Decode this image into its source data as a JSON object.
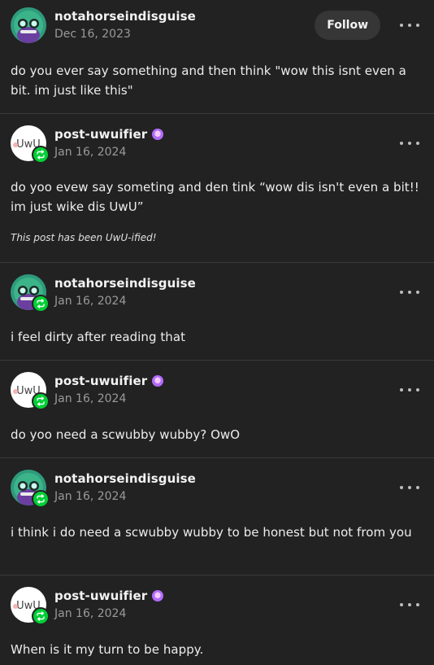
{
  "follow_label": "Follow",
  "uwu_note": "This post has been UwU-ified!",
  "colors": {
    "background": "#222222",
    "reblog_badge": "#00cf35",
    "follow_button": "#363636"
  },
  "posts": [
    {
      "author": "notahorseindisguise",
      "date": "Dec 16, 2023",
      "text": "do you ever say something and then think \"wow this isnt even a bit. im just like this\"",
      "avatar": "horse-glasses-avatar",
      "reblog_icon": false
    },
    {
      "author": "post-uwuifier",
      "date": "Jan 16, 2024",
      "text": "do yoo evew say someting and den tink “wow dis isn't even a bit!! im just wike dis UwU”",
      "avatar": "uwu-face-avatar",
      "reblog_icon": true,
      "badge": "purple-blue-badge-icon"
    },
    {
      "author": "notahorseindisguise",
      "date": "Jan 16, 2024",
      "text": "i feel dirty after reading that",
      "avatar": "horse-glasses-avatar",
      "reblog_icon": true
    },
    {
      "author": "post-uwuifier",
      "date": "Jan 16, 2024",
      "text": "do yoo need a scwubby wubby? OwO",
      "avatar": "uwu-face-avatar",
      "reblog_icon": true,
      "badge": "purple-blue-badge-icon"
    },
    {
      "author": "notahorseindisguise",
      "date": "Jan 16, 2024",
      "text": "i think i do need a scwubby wubby to be honest but not from you",
      "avatar": "horse-glasses-avatar",
      "reblog_icon": true
    },
    {
      "author": "post-uwuifier",
      "date": "Jan 16, 2024",
      "text": "When is it my turn to be happy.",
      "avatar": "uwu-face-avatar",
      "reblog_icon": true,
      "badge": "purple-blue-badge-icon"
    }
  ]
}
